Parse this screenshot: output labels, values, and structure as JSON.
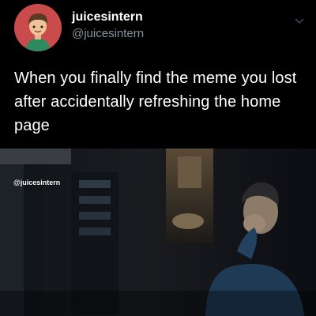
{
  "tweet": {
    "display_name": "juicesintern",
    "handle": "@juicesintern",
    "text": "When you finally find the meme you lost after accidentally refreshing the home page"
  },
  "media": {
    "watermark": "@juicesintern"
  },
  "icons": {
    "options": "chevron-down-icon",
    "avatar": "avatar-illustration"
  },
  "colors": {
    "background": "#000000",
    "handle": "#8a949e",
    "avatar_bg": "#c94b4b"
  }
}
